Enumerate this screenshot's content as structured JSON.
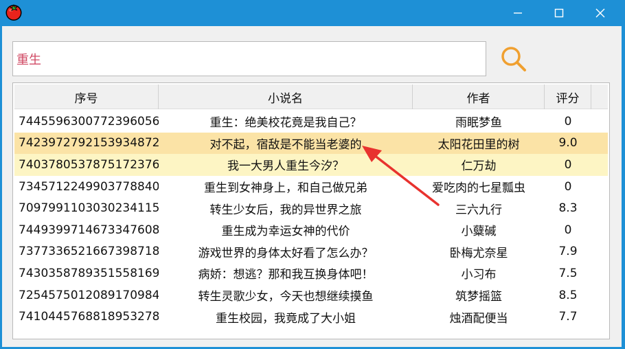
{
  "window": {
    "icon": "tomato-icon",
    "controls": [
      "minimize-icon",
      "maximize-icon",
      "close-icon"
    ]
  },
  "search": {
    "value": "重生",
    "button_icon": "search-icon",
    "accent": "#f0a030"
  },
  "table": {
    "columns": [
      "序号",
      "小说名",
      "作者",
      "评分"
    ],
    "rows": [
      {
        "id": "7445596300772396056",
        "title": "重生：绝美校花竟是我自己？",
        "author": "雨眠梦鱼",
        "score": "0"
      },
      {
        "id": "7423972792153934872",
        "title": "对不起，宿敌是不能当老婆的",
        "author": "太阳花田里的树",
        "score": "9.0"
      },
      {
        "id": "7403780537875172376",
        "title": "我一大男人重生今汐？",
        "author": "仁万劫",
        "score": "0"
      },
      {
        "id": "7345712249903778840",
        "title": "重生到女神身上，和自己做兄弟",
        "author": "爱吃肉的七星瓢虫",
        "score": "0"
      },
      {
        "id": "7097991103030234115",
        "title": "转生少女后，我的异世界之旅",
        "author": "三六九行",
        "score": "8.3"
      },
      {
        "id": "7449399714673347608",
        "title": "重生成为幸运女神的代价",
        "author": "小糵碱",
        "score": "0"
      },
      {
        "id": "7377336521667398718",
        "title": "游戏世界的身体太好看了怎么办？",
        "author": "卧梅尤奈星",
        "score": "7.9"
      },
      {
        "id": "7430358789351558169",
        "title": "病娇：想逃？那和我互换身体吧！",
        "author": "小习布",
        "score": "7.5"
      },
      {
        "id": "7254575012089170984",
        "title": "转生灵歌少女，今天也想继续摸鱼",
        "author": "筑梦摇篮",
        "score": "8.5"
      },
      {
        "id": "7410445768818953278",
        "title": "重生校园，我竟成了大小姐",
        "author": "烛酒配便当",
        "score": "7.7"
      }
    ],
    "highlight_colors": [
      "#fbe3a6",
      "#fdf5c4"
    ]
  },
  "annotation": {
    "arrow_color": "#e8322e"
  }
}
